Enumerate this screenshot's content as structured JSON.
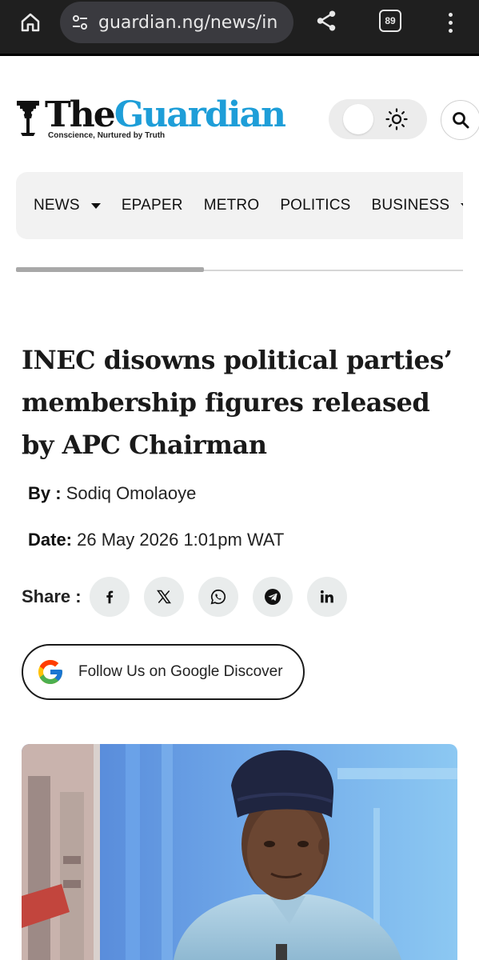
{
  "browser": {
    "url": "guardian.ng/news/in",
    "tab_count": "89",
    "icons": [
      "home-icon",
      "tune-icon",
      "share-icon",
      "tabs-icon",
      "more-vert-icon"
    ]
  },
  "site": {
    "logo_the": "The",
    "logo_guardian": "Guardian",
    "tagline": "Conscience, Nurtured by Truth",
    "brand_color": "#1e9ed8"
  },
  "nav": {
    "items": [
      {
        "label": "NEWS",
        "dropdown": true
      },
      {
        "label": "EPAPER",
        "dropdown": false
      },
      {
        "label": "METRO",
        "dropdown": false
      },
      {
        "label": "POLITICS",
        "dropdown": false
      },
      {
        "label": "BUSINESS",
        "dropdown": true
      }
    ],
    "read_progress": 0.42
  },
  "article": {
    "headline": "INEC disowns political parties’ membership figures released by APC Chairman",
    "by_label": "By :",
    "author": "Sodiq Omolaoye",
    "date_label": "Date:",
    "date": "26 May 2026 1:01pm WAT",
    "share_label": "Share :",
    "share_icons": [
      "facebook-icon",
      "x-icon",
      "whatsapp-icon",
      "telegram-icon",
      "linkedin-icon"
    ],
    "google_discover": "Follow Us on Google Discover"
  }
}
